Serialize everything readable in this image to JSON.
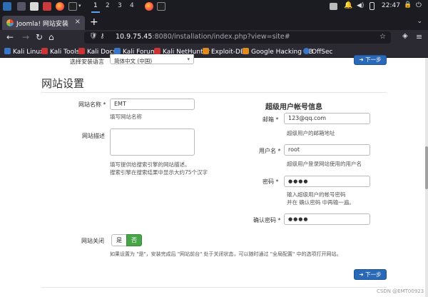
{
  "panel": {
    "workspaces": [
      "1",
      "2",
      "3",
      "4"
    ],
    "active_workspace": "1",
    "clock": "22:47"
  },
  "browser": {
    "tab_title": "Joomla! 网站安装",
    "tab_close": "×",
    "new_tab": "+",
    "url_host": "10.9.75.45",
    "url_rest": ":8080/installation/index.php?view=site#",
    "bookmarks": [
      "Kali Linux",
      "Kali Tools",
      "Kali Docs",
      "Kali Forums",
      "Kali NetHunter",
      "Exploit-DB",
      "Google Hacking DB",
      "OffSec"
    ]
  },
  "page": {
    "language_label": "选择安装语言",
    "language_value": "简体中文 (中国)",
    "next_button": "➜ 下一步",
    "section_title": "网站设置",
    "site_name_label": "网站名称 *",
    "site_name_value": "EMT",
    "site_name_hint": "填写网站名称",
    "site_desc_label": "网站描述",
    "site_desc_hint_1": "填写提供给搜索引擎的网站描述。",
    "site_desc_hint_2": "搜索引擎在搜索结果中显示大约75个汉字",
    "admin_title": "超级用户帐号信息",
    "email_label": "邮箱 *",
    "email_value": "123@qq.com",
    "email_hint": "超级用户的邮箱地址",
    "username_label": "用户名 *",
    "username_value": "root",
    "username_hint": "超级用户登录网站使用的用户名",
    "password_label": "密码 *",
    "password_value": "●●●●",
    "password_hint_1": "输入超级用户的帐号密码",
    "password_hint_2": "并在 确认密码 中再输一遍。",
    "confirm_label": "确认密码 *",
    "confirm_value": "●●●●",
    "offline_label": "网站关闭",
    "offline_yes": "是",
    "offline_no": "否",
    "offline_hint": "如果设置为 \"是\"，安装完成后 \"网站前台\" 处于关闭状态，可以随时通过 \"全局配置\" 中的选项打开网站。",
    "watermark": "CSDN @EMT00923"
  },
  "colors": {
    "primary": "#2a69b8",
    "success": "#46a546"
  }
}
